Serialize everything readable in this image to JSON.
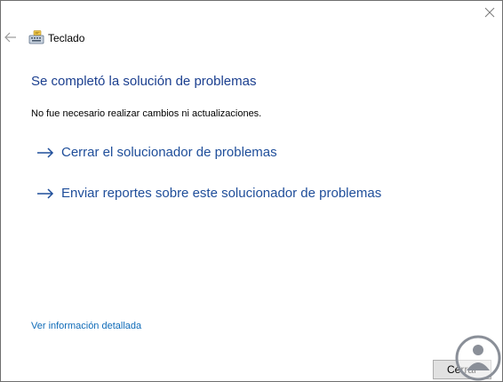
{
  "window": {
    "app_title": "Teclado",
    "close_icon": "close-icon",
    "back_icon": "back-arrow-icon",
    "app_icon": "keyboard-icon"
  },
  "main": {
    "heading": "Se completó la solución de problemas",
    "message": "No fue necesario realizar cambios ni actualizaciones.",
    "actions": [
      {
        "label": "Cerrar el solucionador de problemas",
        "icon": "arrow-right-icon"
      },
      {
        "label": "Enviar reportes sobre este solucionador de problemas",
        "icon": "arrow-right-icon"
      }
    ],
    "details_link": "Ver información detallada"
  },
  "footer": {
    "close_button": "Cerrar"
  },
  "colors": {
    "heading": "#1b3f8f",
    "action_link": "#1f4e9a",
    "details_link": "#0f6bb8",
    "watermark": "#8a8f98"
  }
}
